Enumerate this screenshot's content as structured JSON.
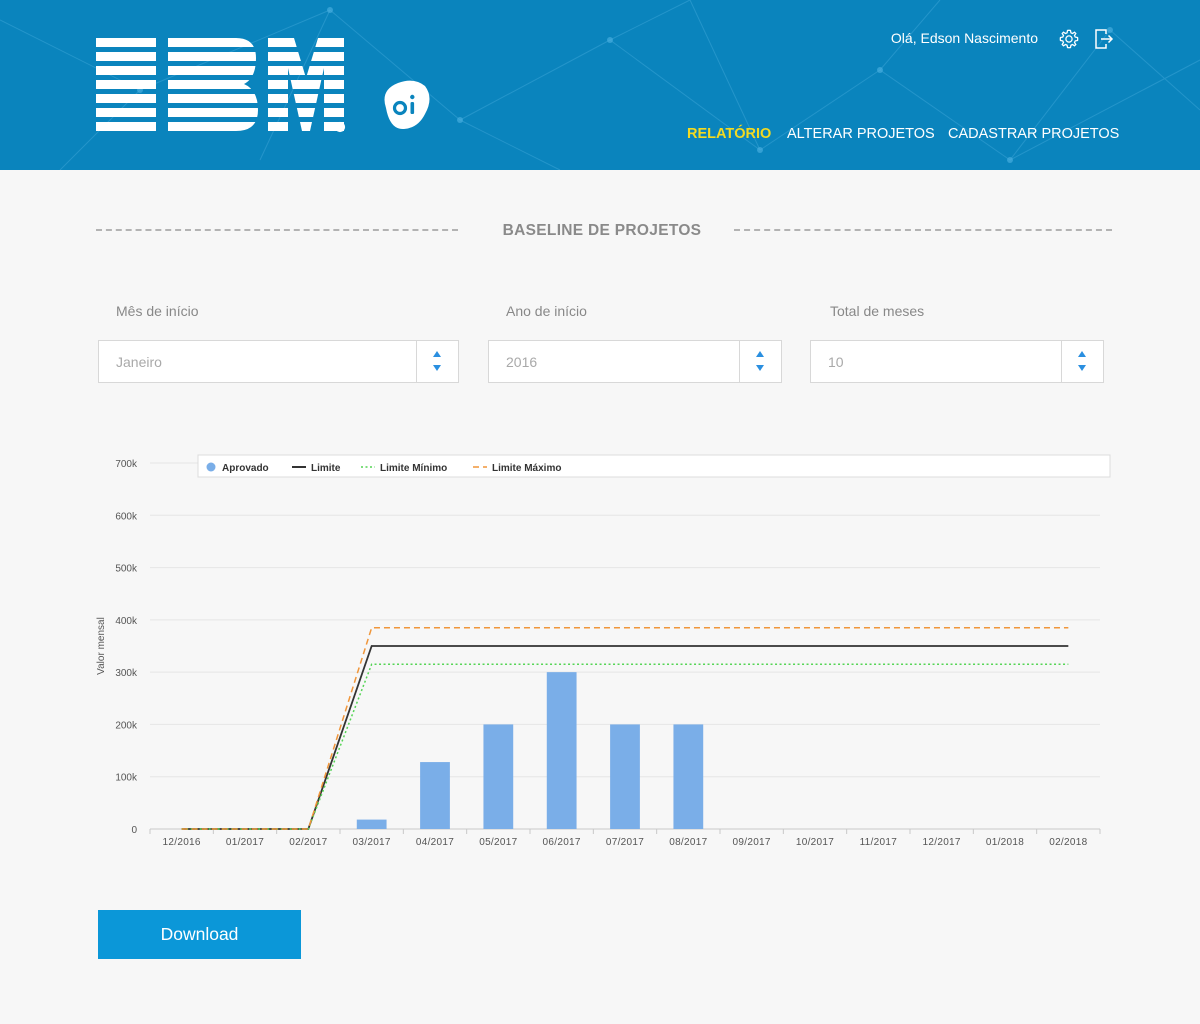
{
  "header": {
    "greeting": "Olá, Edson Nascimento",
    "background_color": "#0a84bd",
    "settings_icon": "gear-icon",
    "logout_icon": "logout-icon",
    "brand_logo": "IBM",
    "partner_logo": "oi",
    "nav": [
      {
        "label": "RELATÓRIO",
        "active": true
      },
      {
        "label": "ALTERAR PROJETOS",
        "active": false
      },
      {
        "label": "CADASTRAR PROJETOS",
        "active": false
      }
    ],
    "active_color": "#f3da21"
  },
  "section": {
    "title": "BASELINE DE PROJETOS"
  },
  "filters": [
    {
      "label": "Mês de início",
      "value": "Janeiro"
    },
    {
      "label": "Ano de início",
      "value": "2016"
    },
    {
      "label": "Total de meses",
      "value": "10"
    }
  ],
  "chart_data": {
    "type": "bar",
    "title": "",
    "xlabel": "",
    "ylabel": "Valor mensal",
    "ylim": [
      0,
      700000
    ],
    "yticks": [
      "0",
      "100k",
      "200k",
      "300k",
      "400k",
      "500k",
      "600k",
      "700k"
    ],
    "grid": true,
    "legend_position": "top",
    "categories": [
      "12/2016",
      "01/2017",
      "02/2017",
      "03/2017",
      "04/2017",
      "05/2017",
      "06/2017",
      "07/2017",
      "08/2017",
      "09/2017",
      "10/2017",
      "11/2017",
      "12/2017",
      "01/2018",
      "02/2018"
    ],
    "series": [
      {
        "name": "Aprovado",
        "kind": "bar",
        "color": "#7aaee8",
        "values": [
          0,
          0,
          0,
          18000,
          128000,
          200000,
          300000,
          200000,
          200000,
          0,
          0,
          0,
          0,
          0,
          0
        ]
      },
      {
        "name": "Limite",
        "kind": "line",
        "style": "solid",
        "color": "#333333",
        "values": [
          0,
          0,
          0,
          350000,
          350000,
          350000,
          350000,
          350000,
          350000,
          350000,
          350000,
          350000,
          350000,
          350000,
          350000
        ]
      },
      {
        "name": "Limite Mínimo",
        "kind": "line",
        "style": "dotted",
        "color": "#55d455",
        "values": [
          0,
          0,
          0,
          315000,
          315000,
          315000,
          315000,
          315000,
          315000,
          315000,
          315000,
          315000,
          315000,
          315000,
          315000
        ]
      },
      {
        "name": "Limite Máximo",
        "kind": "line",
        "style": "dashed",
        "color": "#f0963a",
        "values": [
          0,
          0,
          0,
          385000,
          385000,
          385000,
          385000,
          385000,
          385000,
          385000,
          385000,
          385000,
          385000,
          385000,
          385000
        ]
      }
    ]
  },
  "download": {
    "label": "Download",
    "color": "#0b97d8"
  }
}
